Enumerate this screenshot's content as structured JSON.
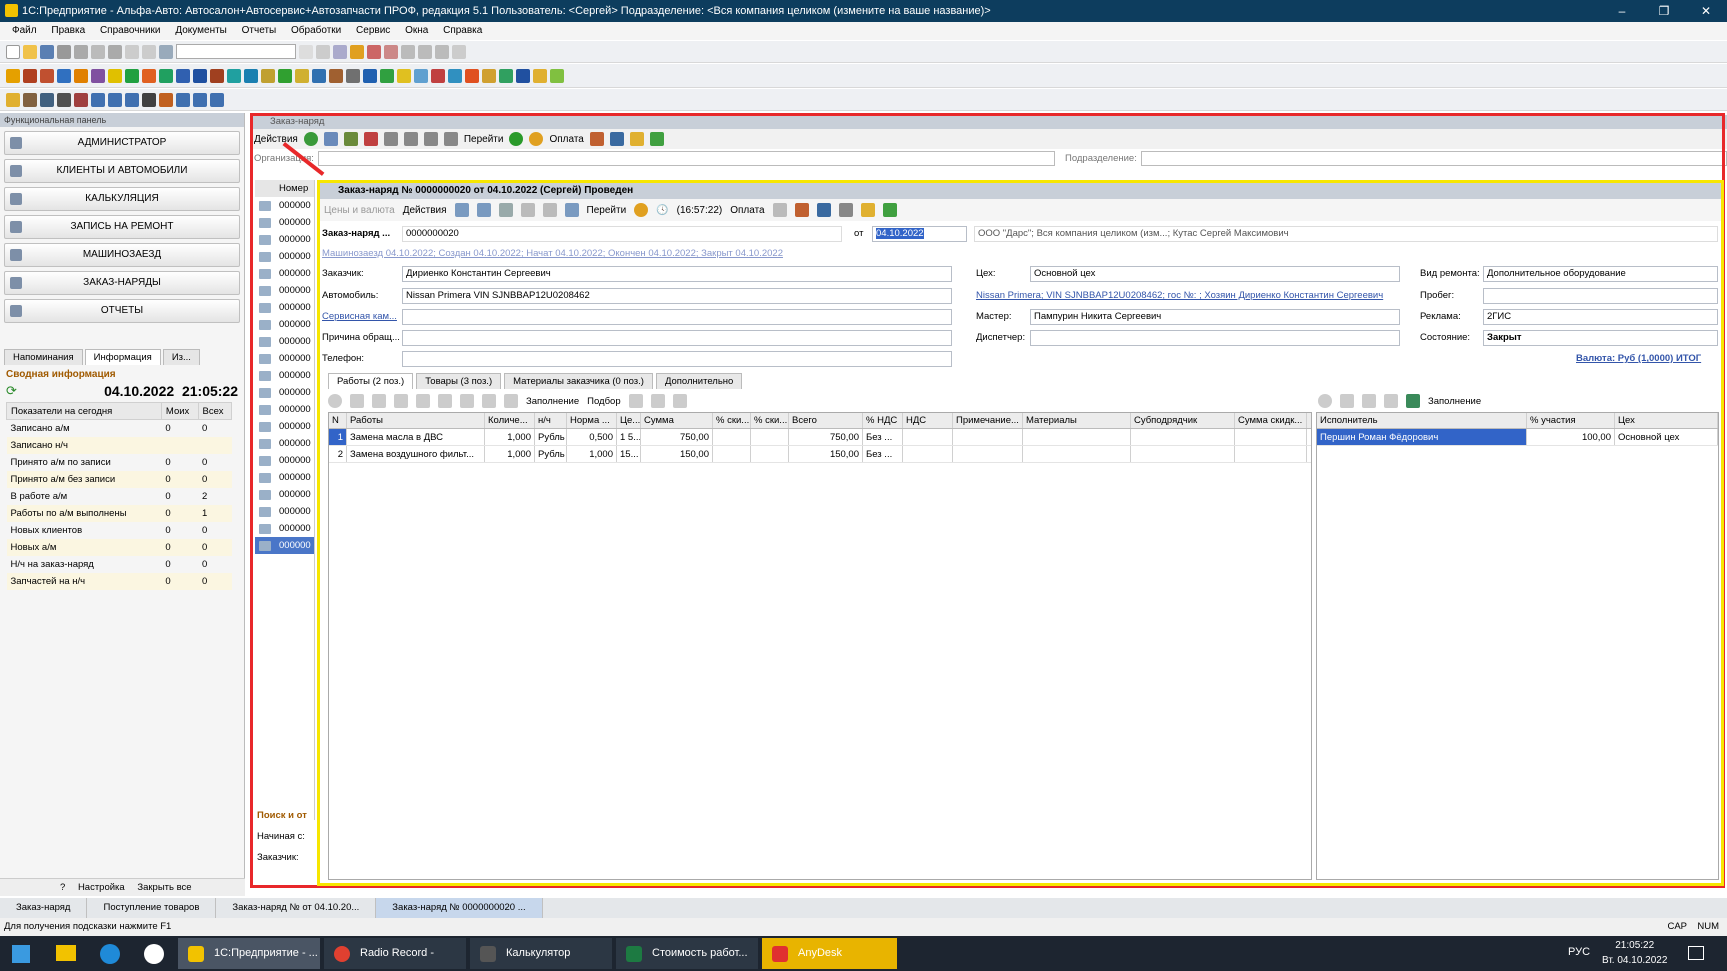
{
  "window": {
    "title": "1С:Предприятие - Альфа-Авто: Автосалон+Автосервис+Автозапчасти ПРОФ, редакция 5.1    Пользователь: <Сергей>    Подразделение: <Вся компания целиком (измените на ваше название)>"
  },
  "menu": [
    "Файл",
    "Правка",
    "Справочники",
    "Документы",
    "Отчеты",
    "Обработки",
    "Сервис",
    "Окна",
    "Справка"
  ],
  "panel": {
    "title": "Функциональная панель",
    "buttons": [
      "АДМИНИСТРАТОР",
      "КЛИЕНТЫ И АВТОМОБИЛИ",
      "КАЛЬКУЛЯЦИЯ",
      "ЗАПИСЬ НА РЕМОНТ",
      "МАШИНОЗАЕЗД",
      "ЗАКАЗ-НАРЯДЫ",
      "ОТЧЕТЫ"
    ],
    "tabs": [
      "Напоминания",
      "Информация",
      "Из..."
    ],
    "summary_title": "Сводная информация",
    "date": "04.10.2022",
    "time": "21:05:22",
    "stats_headers": [
      "Показатели на сегодня",
      "Моих",
      "Всех"
    ],
    "stats": [
      [
        "Записано а/м",
        "0",
        "0"
      ],
      [
        "Записано н/ч",
        "",
        ""
      ],
      [
        "Принято а/м по записи",
        "0",
        "0"
      ],
      [
        "Принято а/м без записи",
        "0",
        "0"
      ],
      [
        "В работе а/м",
        "0",
        "2"
      ],
      [
        "Работы по а/м выполнены",
        "0",
        "1"
      ],
      [
        "Новых клиентов",
        "0",
        "0"
      ],
      [
        "Новых а/м",
        "0",
        "0"
      ],
      [
        "Н/ч на заказ-наряд",
        "0",
        "0"
      ],
      [
        "Запчастей на н/ч",
        "0",
        "0"
      ]
    ],
    "footer": {
      "settings": "Настройка",
      "close_all": "Закрыть все"
    }
  },
  "list": {
    "title": "Заказ-наряд",
    "actions": "Действия",
    "goto": "Перейти",
    "payment": "Оплата",
    "org_label": "Организация:",
    "dept_label": "Подразделение:",
    "col_number": "Номер",
    "rows": [
      "000000",
      "000000",
      "000000",
      "000000",
      "000000",
      "000000",
      "000000",
      "000000",
      "000000",
      "000000",
      "000000",
      "000000",
      "000000",
      "000000",
      "000000",
      "000000",
      "000000",
      "000000",
      "000000",
      "000000",
      "000000"
    ],
    "search_title": "Поиск и от",
    "search_from": "Начиная с:",
    "search_customer": "Заказчик:"
  },
  "doc": {
    "header": "Заказ-наряд № 0000000020 от 04.10.2022 (Сергей) Проведен",
    "prices": "Цены и валюта",
    "actions": "Действия",
    "goto": "Перейти",
    "time": "(16:57:22)",
    "payment": "Оплата",
    "number_label": "Заказ-наряд ...",
    "number": "0000000020",
    "from_label": "от",
    "date": "04.10.2022",
    "org_info": "ООО \"Дарс\"; Вся компания целиком (изм...; Кутас Сергей Максимович",
    "status_link": "Машинозаезд 04.10.2022; Создан 04.10.2022; Начат 04.10.2022; Окончен 04.10.2022; Закрыт 04.10.2022",
    "customer_label": "Заказчик:",
    "customer": "Дириенко Константин Сергеевич",
    "car_label": "Автомобиль:",
    "car": "Nissan Primera VIN SJNBBAP12U0208462",
    "service_label": "Сервисная кам...",
    "reason_label": "Причина обращ...",
    "phone_label": "Телефон:",
    "shop_label": "Цех:",
    "shop": "Основной цех",
    "car_link": "Nissan Primera; VIN SJNBBAP12U0208462; гос №: ; Хозяин Дириенко Константин Сергеевич",
    "master_label": "Мастер:",
    "master": "Пампурин Никита Сергеевич",
    "dispatcher_label": "Диспетчер:",
    "repair_label": "Вид ремонта:",
    "repair": "Дополнительное оборудование",
    "mileage_label": "Пробег:",
    "ad_label": "Реклама:",
    "ad": "2ГИС",
    "state_label": "Состояние:",
    "state": "Закрыт",
    "currency": "Валюта: Руб (1,0000) ИТОГ",
    "tabs": [
      "Работы (2 поз.)",
      "Товары (3 поз.)",
      "Материалы заказчика (0 поз.)",
      "Дополнительно"
    ],
    "fill": "Заполнение",
    "pick": "Подбор",
    "works_cols": [
      "N",
      "Работы",
      "Количе...",
      "н/ч",
      "Норма ...",
      "Це...",
      "Сумма",
      "% ски...",
      "% ски...",
      "Всего",
      "% НДС",
      "НДС",
      "Примечание...",
      "Материалы",
      "Субподрядчик",
      "Сумма скидк..."
    ],
    "works": [
      [
        "1",
        "Замена масла в ДВС",
        "1,000",
        "Рубль",
        "0,500",
        "1 5...",
        "750,00",
        "",
        "",
        "750,00",
        "Без ...",
        "",
        "",
        "",
        "",
        ""
      ],
      [
        "2",
        "Замена воздушного фильт...",
        "1,000",
        "Рубль",
        "1,000",
        "15...",
        "150,00",
        "",
        "",
        "150,00",
        "Без ...",
        "",
        "",
        "",
        "",
        ""
      ]
    ],
    "exec_fill": "Заполнение",
    "exec_cols": [
      "Исполнитель",
      "% участия",
      "Цех"
    ],
    "exec": [
      [
        "Першин Роман Фёдорович",
        "100,00",
        "Основной цех"
      ]
    ]
  },
  "window_tabs": [
    "Заказ-наряд",
    "Поступление товаров",
    "Заказ-наряд №  от 04.10.20...",
    "Заказ-наряд № 0000000020 ..."
  ],
  "status": {
    "hint": "Для получения подсказки нажмите F1",
    "caps": "CAP",
    "num": "NUM"
  },
  "taskbar": {
    "apps": [
      "1С:Предприятие - ...",
      "Radio Record - Goo...",
      "Калькулятор",
      "Стоимость работ...",
      "AnyDesk"
    ],
    "lang": "РУС",
    "time": "21:05:22",
    "date": "Вт. 04.10.2022"
  }
}
